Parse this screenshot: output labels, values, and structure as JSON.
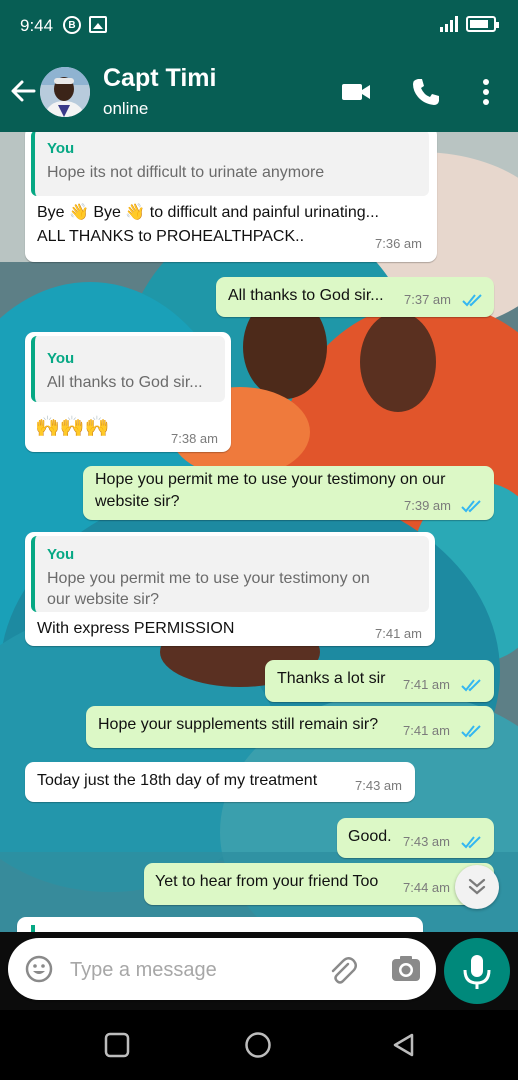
{
  "status_bar": {
    "time": "9:44",
    "icons": [
      "b-badge-icon",
      "image-icon",
      "signal-icon",
      "battery-icon"
    ]
  },
  "header": {
    "contact_name": "Capt Timi",
    "contact_status": "online",
    "icons": [
      "back-arrow-icon",
      "video-call-icon",
      "phone-icon",
      "more-vert-icon"
    ]
  },
  "colors": {
    "header_bg": "#075e54",
    "incoming_bubble": "#ffffff",
    "outgoing_bubble": "#dcf8c6",
    "quote_accent": "#06a884",
    "read_ticks": "#34b7f1",
    "mic_button": "#00897b"
  },
  "messages": [
    {
      "direction": "in",
      "quote_author": "You",
      "quote_text": "Hope its not difficult to urinate anymore",
      "text_line1": "Bye 👋 Bye 👋 to difficult and painful urinating...",
      "text_line2": "ALL THANKS to PROHEALTHPACK..",
      "time": "7:36 am"
    },
    {
      "direction": "out",
      "text": "All thanks to God sir...",
      "time": "7:37 am",
      "read": true
    },
    {
      "direction": "in",
      "quote_author": "You",
      "quote_text": "All thanks to God sir...",
      "text": "🙌🙌🙌",
      "time": "7:38 am"
    },
    {
      "direction": "out",
      "text_line1": "Hope you permit me to use your testimony on our",
      "text_line2": "website sir?",
      "time": "7:39 am",
      "read": true
    },
    {
      "direction": "in",
      "quote_author": "You",
      "quote_line1": "Hope you permit me to use your testimony on",
      "quote_line2": "our website sir?",
      "text": "With express PERMISSION",
      "time": "7:41 am"
    },
    {
      "direction": "out",
      "text": "Thanks a lot sir",
      "time": "7:41 am",
      "read": true
    },
    {
      "direction": "out",
      "text": "Hope your supplements still remain sir?",
      "time": "7:41 am",
      "read": true
    },
    {
      "direction": "in",
      "text": "Today just the 18th day of my treatment",
      "time": "7:43 am"
    },
    {
      "direction": "out",
      "text": "Good.",
      "time": "7:43 am",
      "read": true
    },
    {
      "direction": "out",
      "text": "Yet to hear from your friend Too",
      "time": "7:44 am",
      "read": true
    }
  ],
  "input": {
    "placeholder": "Type a message",
    "value": ""
  },
  "nav": [
    "recents-square-icon",
    "home-circle-icon",
    "back-triangle-icon"
  ]
}
